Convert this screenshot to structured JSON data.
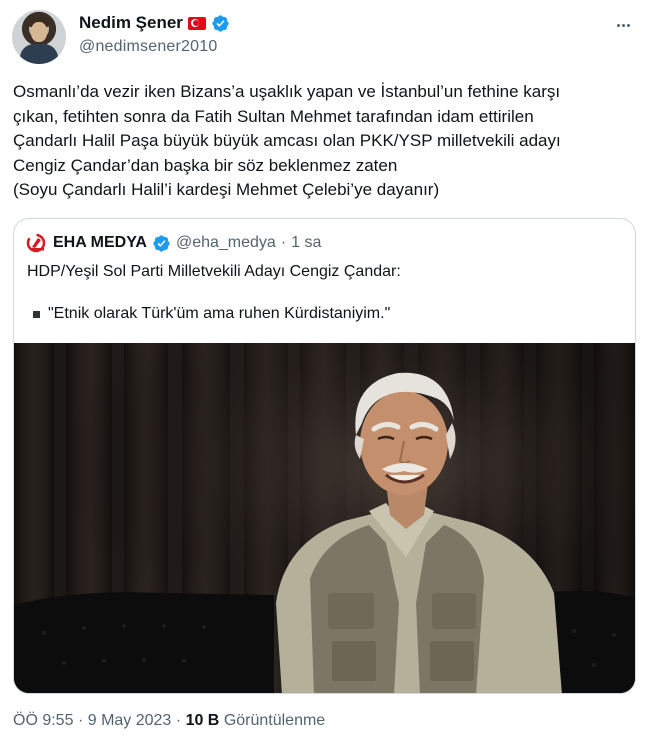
{
  "author": {
    "display_name": "Nedim Şener",
    "handle": "@nedimsener2010",
    "icons": [
      "turkey-flag-icon",
      "verified-badge-icon"
    ]
  },
  "tweet": {
    "lines": [
      "Osmanlı’da vezir iken Bizans’a uşaklık yapan ve İstanbul’un fethine karşı",
      "çıkan, fetihten sonra da Fatih Sultan Mehmet tarafından idam ettirilen",
      "Çandarlı Halil Paşa büyük büyük amcası olan PKK/YSP milletvekili adayı",
      "Cengiz Çandar’dan başka bir söz beklenmez zaten",
      "(Soyu Çandarlı Halil’i kardeşi Mehmet Çelebi’ye dayanır)"
    ]
  },
  "quote": {
    "display_name": "EHA MEDYA",
    "handle": "@eha_medya",
    "separator": "·",
    "time": "1 sa",
    "text_line_1": "HDP/Yeşil Sol Parti Milletvekili Adayı Cengiz Çandar:",
    "text_line_2": "\"Etnik olarak Türk'üm ama ruhen Kürdistaniyim.\""
  },
  "meta": {
    "time": "ÖÖ 9:55",
    "separator_1": "·",
    "date": "9 May 2023",
    "separator_2": "·",
    "views_count": "10 B",
    "views_label": "Görüntülenme"
  },
  "colors": {
    "text_primary": "#0f1419",
    "text_secondary": "#536471",
    "border": "#cfd9de",
    "verified_blue": "#1d9bf0",
    "flag_red": "#e30a17",
    "eha_red": "#d71920"
  }
}
